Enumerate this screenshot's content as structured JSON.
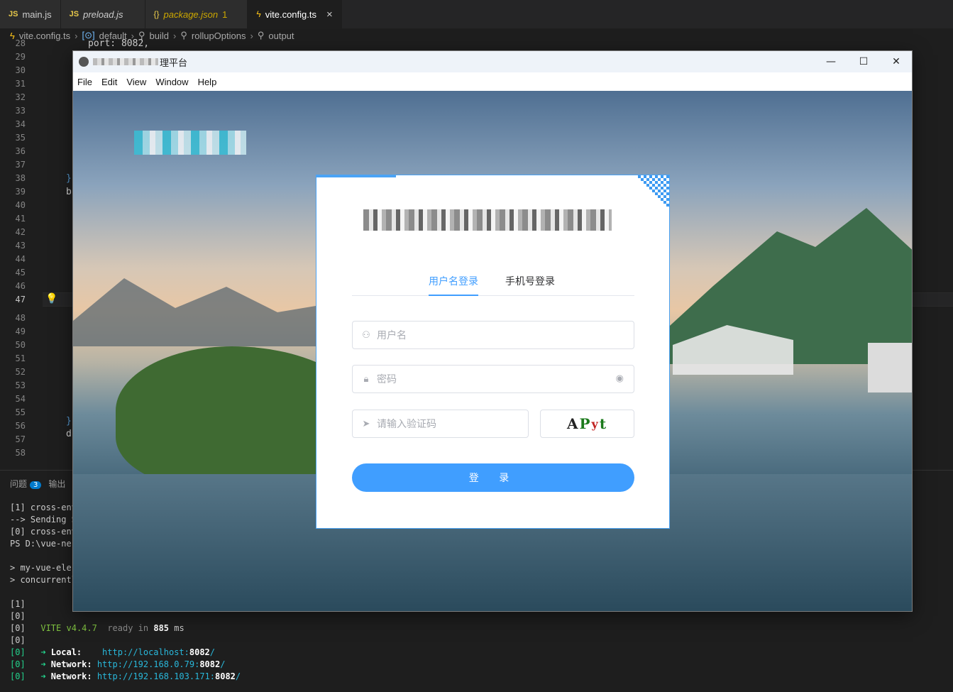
{
  "editor": {
    "tabs": [
      {
        "icon": "JS",
        "label": "main.js"
      },
      {
        "icon": "JS",
        "label": "preload.js"
      },
      {
        "icon": "{}",
        "label": "package.json",
        "badge": "1"
      },
      {
        "icon": "vite",
        "label": "vite.config.ts",
        "close": "×"
      }
    ],
    "breadcrumb": [
      "vite.config.ts",
      "default",
      "build",
      "rollupOptions",
      "output"
    ],
    "line_numbers": [
      "28",
      "29",
      "30",
      "31",
      "32",
      "33",
      "34",
      "35",
      "36",
      "37",
      "38",
      "39",
      "40",
      "41",
      "42",
      "43",
      "44",
      "45",
      "46",
      "47",
      "48",
      "49",
      "50",
      "51",
      "52",
      "53",
      "54",
      "55",
      "56",
      "57",
      "58"
    ],
    "visible_code": {
      "port_line": "port: 8082,",
      "brace_38": "}",
      "b_39": "b",
      "brace_55": "}",
      "d_56": "d"
    }
  },
  "panel": {
    "tab_problems": "问题",
    "problems_count": "3",
    "tab_output": "输出",
    "terminal_lines": [
      "[1] cross-env",
      "--> Sending S",
      "[0] cross-env",
      "PS D:\\vue-ne",
      "",
      "> my-vue-ele",
      "> concurrentl",
      "",
      "[1]",
      "[0]"
    ],
    "vite_line": {
      "prefix": "[0]   ",
      "name": "VITE",
      "version": "v4.4.7",
      "ready": "ready in",
      "ms_value": "885",
      "ms": "ms"
    },
    "blank_line": "[0]",
    "local": {
      "prefix": "[0]   ➜ ",
      "label": "Local:  ",
      "url_a": "http://localhost:",
      "port": "8082",
      "url_b": "/"
    },
    "network1": {
      "prefix": "[0]   ➜ ",
      "label": "Network:",
      "url_a": "http://192.168.0.79:",
      "port": "8082",
      "url_b": "/"
    },
    "network2": {
      "prefix": "[0]   ➜ ",
      "label": "Network:",
      "url_a": "http://192.168.103.171:",
      "port": "8082",
      "url_b": "/"
    }
  },
  "app_window": {
    "title_suffix": "理平台",
    "controls": {
      "minimize": "—",
      "maximize": "☐",
      "close": "✕"
    },
    "menu": [
      "File",
      "Edit",
      "View",
      "Window",
      "Help"
    ]
  },
  "login": {
    "tabs": [
      "用户名登录",
      "手机号登录"
    ],
    "active_tab": 0,
    "username_placeholder": "用户名",
    "password_placeholder": "密码",
    "captcha_placeholder": "请输入验证码",
    "captcha_text": [
      "A",
      "P",
      "y",
      "t"
    ],
    "submit_label": "登 录"
  },
  "colors": {
    "accent": "#409eff",
    "editor_bg": "#1e1e1e"
  }
}
